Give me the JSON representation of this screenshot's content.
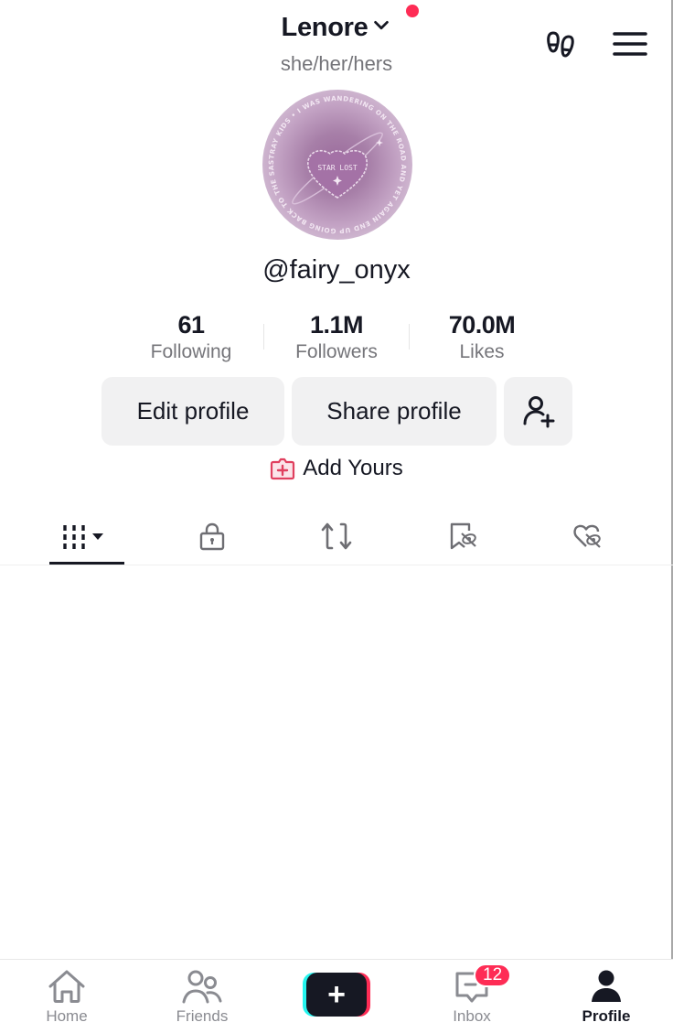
{
  "header": {
    "username": "Lenore",
    "pronouns": "she/her/hers",
    "notification_dot_color": "#fe2c55",
    "icons": [
      "chevron-down-icon",
      "footprints-icon",
      "menu-icon"
    ]
  },
  "profile": {
    "avatar_text_ring": "STRAY KIDS • I WAS WANDERING ON THE ROAD AND YET AGAIN END UP GOING BACK TO THE SAME PLACE •",
    "avatar_center_text": "STAR LOST",
    "handle": "@fairy_onyx"
  },
  "stats": [
    {
      "value": "61",
      "label": "Following"
    },
    {
      "value": "1.1M",
      "label": "Followers"
    },
    {
      "value": "70.0M",
      "label": "Likes"
    }
  ],
  "actions": {
    "edit_profile": "Edit profile",
    "share_profile": "Share profile",
    "add_friend_icon": "person-add-icon",
    "add_yours": "Add Yours",
    "add_yours_color": "#e0405f"
  },
  "tabs": [
    {
      "name": "videos",
      "icon": "grid-icon",
      "active": true
    },
    {
      "name": "private",
      "icon": "lock-icon",
      "active": false
    },
    {
      "name": "reposts",
      "icon": "repost-icon",
      "active": false
    },
    {
      "name": "favorites",
      "icon": "bookmark-hidden-icon",
      "active": false
    },
    {
      "name": "liked",
      "icon": "heart-hidden-icon",
      "active": false
    }
  ],
  "bottom_nav": {
    "items": [
      {
        "label": "Home",
        "icon": "home-icon",
        "active": false
      },
      {
        "label": "Friends",
        "icon": "friends-icon",
        "active": false
      },
      {
        "label": "",
        "icon": "create-plus-icon",
        "active": false
      },
      {
        "label": "Inbox",
        "icon": "inbox-icon",
        "active": false
      },
      {
        "label": "Profile",
        "icon": "profile-icon",
        "active": true
      }
    ],
    "inbox_badge": "12",
    "create_symbol": "+"
  }
}
